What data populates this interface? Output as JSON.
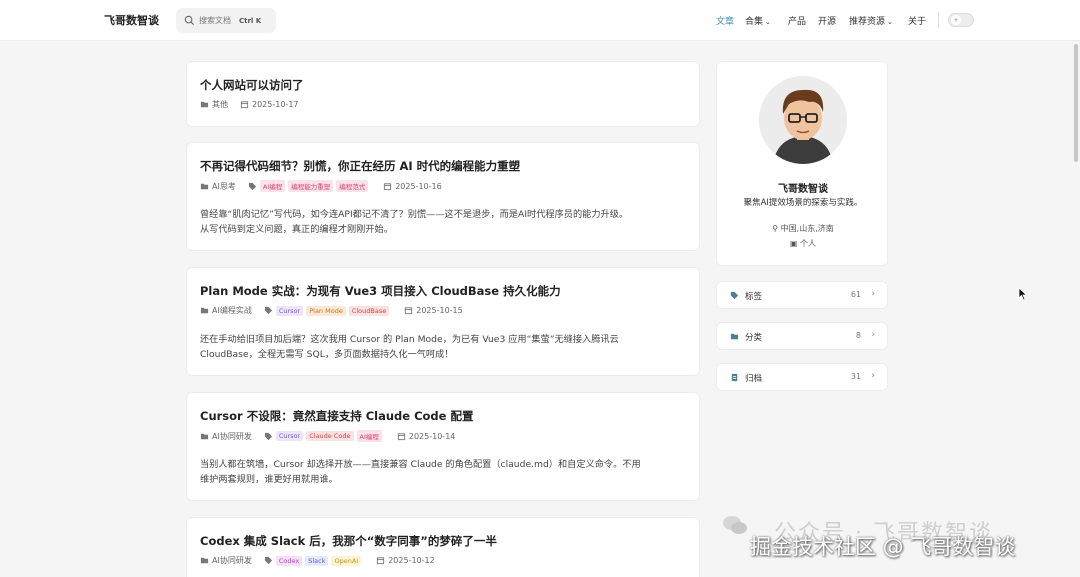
{
  "header": {
    "brand": "飞哥数智谈",
    "search_placeholder": "搜索文档",
    "search_shortcut": "Ctrl K",
    "nav": [
      {
        "label": "文章",
        "active": true
      },
      {
        "label": "合集",
        "dropdown": true
      },
      {
        "label": "产品"
      },
      {
        "label": "开源"
      },
      {
        "label": "推荐资源",
        "dropdown": true
      },
      {
        "label": "关于"
      }
    ]
  },
  "posts": [
    {
      "title": "个人网站可以访问了",
      "category": "其他",
      "tags": [],
      "date": "2025-10-17",
      "excerpt": []
    },
    {
      "title": "不再记得代码细节？别慌，你正在经历 AI 时代的编程能力重塑",
      "category": "AI思考",
      "tags": [
        "AI编程",
        "编程能力重塑",
        "编程范式"
      ],
      "date": "2025-10-16",
      "excerpt": [
        "曾经靠“肌肉记忆”写代码，如今连API都记不清了？别慌——这不是退步，而是AI时代程序员的能力升级。",
        "从写代码到定义问题，真正的编程才刚刚开始。"
      ]
    },
    {
      "title": "Plan Mode 实战：为现有 Vue3 项目接入 CloudBase 持久化能力",
      "category": "AI编程实战",
      "tags": [
        "Cursor",
        "Plan Mode",
        "CloudBase"
      ],
      "date": "2025-10-15",
      "excerpt": [
        "还在手动给旧项目加后端？这次我用 Cursor 的 Plan Mode，为已有 Vue3 应用“集萤”无缝接入腾讯云",
        "CloudBase，全程无需写 SQL，多页面数据持久化一气呵成！"
      ]
    },
    {
      "title": "Cursor 不设限：竟然直接支持 Claude Code 配置",
      "category": "AI协同研发",
      "tags": [
        "Cursor",
        "Claude Code",
        "AI编程"
      ],
      "date": "2025-10-14",
      "excerpt": [
        "当别人都在筑墙，Cursor 却选择开放——直接兼容 Claude 的角色配置（claude.md）和自定义命令。不用",
        "维护两套规则，谁更好用就用谁。"
      ]
    },
    {
      "title": "Codex 集成 Slack 后，我那个“数字同事”的梦碎了一半",
      "category": "AI协同研发",
      "tags": [
        "Codex",
        "Slack",
        "OpenAI"
      ],
      "date": "2025-10-12",
      "excerpt": []
    }
  ],
  "tag_colors": {
    "AI编程": {
      "bg": "#fbe1ea",
      "fg": "#d0466f"
    },
    "编程能力重塑": {
      "bg": "#fbe1ea",
      "fg": "#d0466f"
    },
    "编程范式": {
      "bg": "#fbe1ea",
      "fg": "#d0466f"
    },
    "Cursor": {
      "bg": "#ede6fb",
      "fg": "#7b55d6"
    },
    "Plan Mode": {
      "bg": "#fbe8d6",
      "fg": "#c8741f"
    },
    "CloudBase": {
      "bg": "#fbe1e1",
      "fg": "#d04646"
    },
    "Claude Code": {
      "bg": "#fbe1e1",
      "fg": "#d04646"
    },
    "Codex": {
      "bg": "#f6e0f8",
      "fg": "#b243c4"
    },
    "Slack": {
      "bg": "#e6e8fb",
      "fg": "#5561d6"
    },
    "OpenAI": {
      "bg": "#fbf3d3",
      "fg": "#c39a10"
    }
  },
  "profile": {
    "name": "飞哥数智谈",
    "bio": "聚焦AI提效场景的探索与实践。",
    "location": "中国,山东,济南",
    "type": "个人"
  },
  "sidebar": [
    {
      "label": "标签",
      "count": "61",
      "icon": "tag-icon"
    },
    {
      "label": "分类",
      "count": "8",
      "icon": "folder-icon"
    },
    {
      "label": "归档",
      "count": "31",
      "icon": "archive-icon"
    }
  ],
  "watermark": {
    "line1": "公众号 · 飞哥数智谈",
    "line2": "掘金技术社区 @ 飞哥数智谈"
  }
}
